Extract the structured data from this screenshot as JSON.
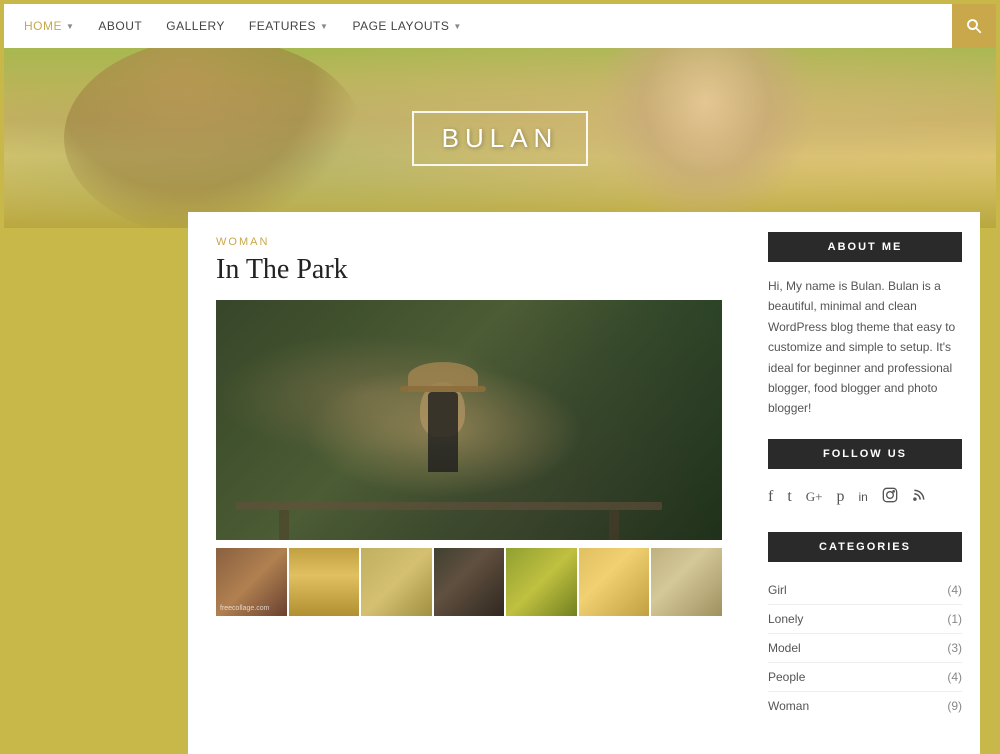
{
  "nav": {
    "items": [
      {
        "label": "HOME",
        "active": true,
        "hasDropdown": true
      },
      {
        "label": "ABOUT",
        "active": false,
        "hasDropdown": false
      },
      {
        "label": "GALLERY",
        "active": false,
        "hasDropdown": false
      },
      {
        "label": "FEATURES",
        "active": false,
        "hasDropdown": true
      },
      {
        "label": "PAGE LAYOUTS",
        "active": false,
        "hasDropdown": true
      }
    ],
    "searchTitle": "Search"
  },
  "hero": {
    "title": "BULAN"
  },
  "post": {
    "category": "WOMAN",
    "title": "In The Park",
    "watermark": "freecollage.com"
  },
  "sidebar": {
    "aboutMe": {
      "header": "ABOUT ME",
      "text": "Hi, My name is Bulan. Bulan is a beautiful, minimal and clean WordPress blog theme that easy to customize and simple to setup. It's ideal for beginner and professional blogger, food blogger and photo blogger!"
    },
    "followUs": {
      "header": "FOLLOW US",
      "icons": [
        "f",
        "t",
        "g+",
        "p",
        "in",
        "cam",
        "rss"
      ]
    },
    "categories": {
      "header": "CATEGORIES",
      "items": [
        {
          "name": "Girl",
          "count": "(4)"
        },
        {
          "name": "Lonely",
          "count": "(1)"
        },
        {
          "name": "Model",
          "count": "(3)"
        },
        {
          "name": "People",
          "count": "(4)"
        },
        {
          "name": "Woman",
          "count": "(9)"
        }
      ]
    }
  }
}
